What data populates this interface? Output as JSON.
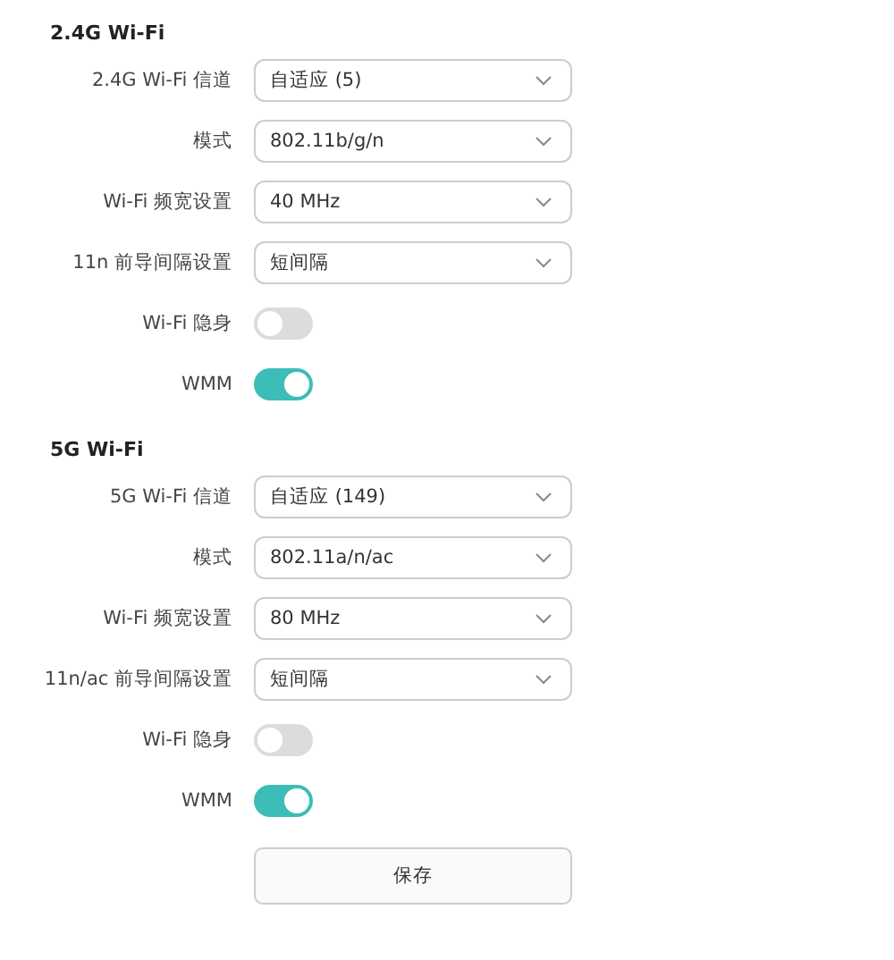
{
  "sections": [
    {
      "title": "2.4G Wi-Fi",
      "rows": [
        {
          "kind": "select",
          "label": "2.4G Wi-Fi 信道",
          "value": "自适应 (5)"
        },
        {
          "kind": "select",
          "label": "模式",
          "value": "802.11b/g/n"
        },
        {
          "kind": "select",
          "label": "Wi-Fi 频宽设置",
          "value": "40 MHz"
        },
        {
          "kind": "select",
          "label": "11n 前导间隔设置",
          "value": "短间隔"
        },
        {
          "kind": "toggle",
          "label": "Wi-Fi 隐身",
          "on": false
        },
        {
          "kind": "toggle",
          "label": "WMM",
          "on": true
        }
      ]
    },
    {
      "title": "5G Wi-Fi",
      "rows": [
        {
          "kind": "select",
          "label": "5G Wi-Fi 信道",
          "value": "自适应 (149)"
        },
        {
          "kind": "select",
          "label": "模式",
          "value": "802.11a/n/ac"
        },
        {
          "kind": "select",
          "label": "Wi-Fi 频宽设置",
          "value": "80 MHz"
        },
        {
          "kind": "select",
          "label": "11n/ac 前导间隔设置",
          "value": "短间隔"
        },
        {
          "kind": "toggle",
          "label": "Wi-Fi 隐身",
          "on": false
        },
        {
          "kind": "toggle",
          "label": "WMM",
          "on": true
        }
      ]
    }
  ],
  "save_button": "保存"
}
